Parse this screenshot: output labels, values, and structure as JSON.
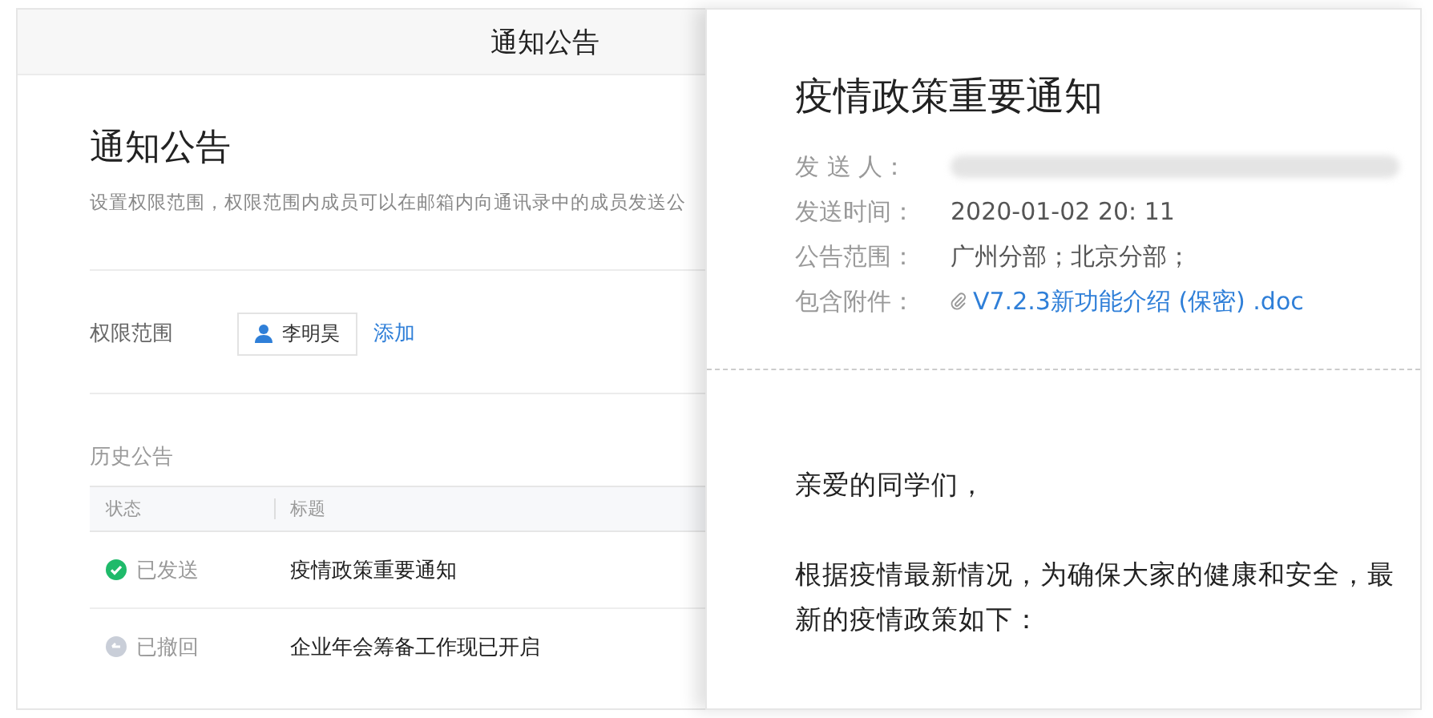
{
  "settings_panel": {
    "header_title": "通知公告",
    "title": "通知公告",
    "description": "设置权限范围，权限范围内成员可以在邮箱内向通讯录中的成员发送公",
    "permission": {
      "label": "权限范围",
      "members": [
        "李明昊"
      ],
      "add_link": "添加"
    },
    "history": {
      "title": "历史公告",
      "columns": [
        "状态",
        "标题"
      ],
      "rows": [
        {
          "kind": "sent",
          "status": "已发送",
          "title": "疫情政策重要通知"
        },
        {
          "kind": "withdrawn",
          "status": "已撤回",
          "title": "企业年会筹备工作现已开启"
        }
      ]
    }
  },
  "preview": {
    "title": "疫情政策重要通知",
    "meta": [
      {
        "kind": "blurred",
        "label": "发 送 人："
      },
      {
        "kind": "text",
        "label": "发送时间：",
        "value": "2020-01-02 20: 11"
      },
      {
        "kind": "text",
        "label": "公告范围：",
        "value": "广州分部；北京分部；"
      },
      {
        "kind": "attachment",
        "label": "包含附件：",
        "value": "V7.2.3新功能介绍 (保密) .doc"
      }
    ],
    "body": [
      "亲爱的同学们，",
      "根据疫情最新情况，为确保大家的健康和安全，最新的疫情政策如下："
    ]
  }
}
